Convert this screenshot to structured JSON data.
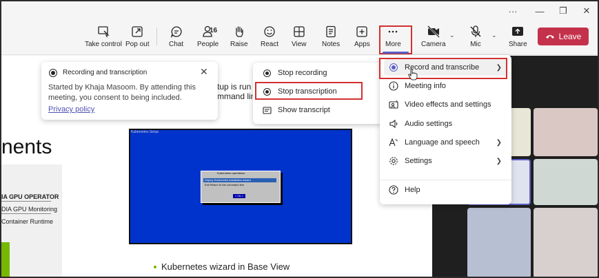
{
  "window": {
    "controls": [
      "···",
      "—",
      "❐",
      "✕"
    ]
  },
  "toolbar": {
    "buttons": [
      {
        "label": "Take control",
        "icon": "take-control-icon"
      },
      {
        "label": "Pop out",
        "icon": "pop-out-icon"
      },
      {
        "label": "Chat",
        "icon": "chat-icon"
      },
      {
        "label": "People",
        "icon": "people-icon",
        "count": "16"
      },
      {
        "label": "Raise",
        "icon": "raise-hand-icon"
      },
      {
        "label": "React",
        "icon": "react-icon"
      },
      {
        "label": "View",
        "icon": "view-icon"
      },
      {
        "label": "Notes",
        "icon": "notes-icon"
      },
      {
        "label": "Apps",
        "icon": "apps-icon"
      },
      {
        "label": "More",
        "icon": "more-icon"
      },
      {
        "label": "Camera",
        "icon": "camera-off-icon"
      },
      {
        "label": "Mic",
        "icon": "mic-off-icon"
      },
      {
        "label": "Share",
        "icon": "share-icon"
      }
    ],
    "leave_label": "Leave",
    "leave_color": "#c4314b",
    "accent_color": "#5b5fc7"
  },
  "recording_banner": {
    "title": "Recording and transcription",
    "body": "Started by Khaja Masoom. By attending this meeting, you consent to being included.",
    "link": "Privacy policy"
  },
  "submenu": {
    "items": [
      {
        "label": "Stop recording",
        "icon": "stop-recording-icon"
      },
      {
        "label": "Stop transcription",
        "icon": "stop-transcription-icon"
      },
      {
        "label": "Show transcript",
        "icon": "transcript-icon"
      }
    ]
  },
  "more_menu": {
    "items": [
      {
        "label": "Record and transcribe",
        "icon": "record-icon",
        "has_submenu": true
      },
      {
        "label": "Meeting info",
        "icon": "info-icon",
        "has_submenu": false
      },
      {
        "label": "Video effects and settings",
        "icon": "video-effects-icon",
        "has_submenu": false
      },
      {
        "label": "Audio settings",
        "icon": "audio-settings-icon",
        "has_submenu": false
      },
      {
        "label": "Language and speech",
        "icon": "language-icon",
        "has_submenu": true
      },
      {
        "label": "Settings",
        "icon": "settings-icon",
        "has_submenu": true
      }
    ],
    "help_label": "Help"
  },
  "slide": {
    "title_partial": "nents",
    "panel_lines": [
      "IA GPU OPERATOR",
      "DIA GPU Monitoring",
      "Container Runtime"
    ],
    "partial_right_1": "tup is run",
    "partial_right_2": "mmand lin",
    "blue_screen_title": "Kubernetes Setup",
    "dialog_title": "Kubernetes operations",
    "dialog_row1": "Deploy   Kubernetes installation wizard",
    "dialog_row2": "Exit      Return to the command line",
    "dialog_ok": "< Ok >",
    "bullet": "Kubernetes wizard in Base View"
  }
}
